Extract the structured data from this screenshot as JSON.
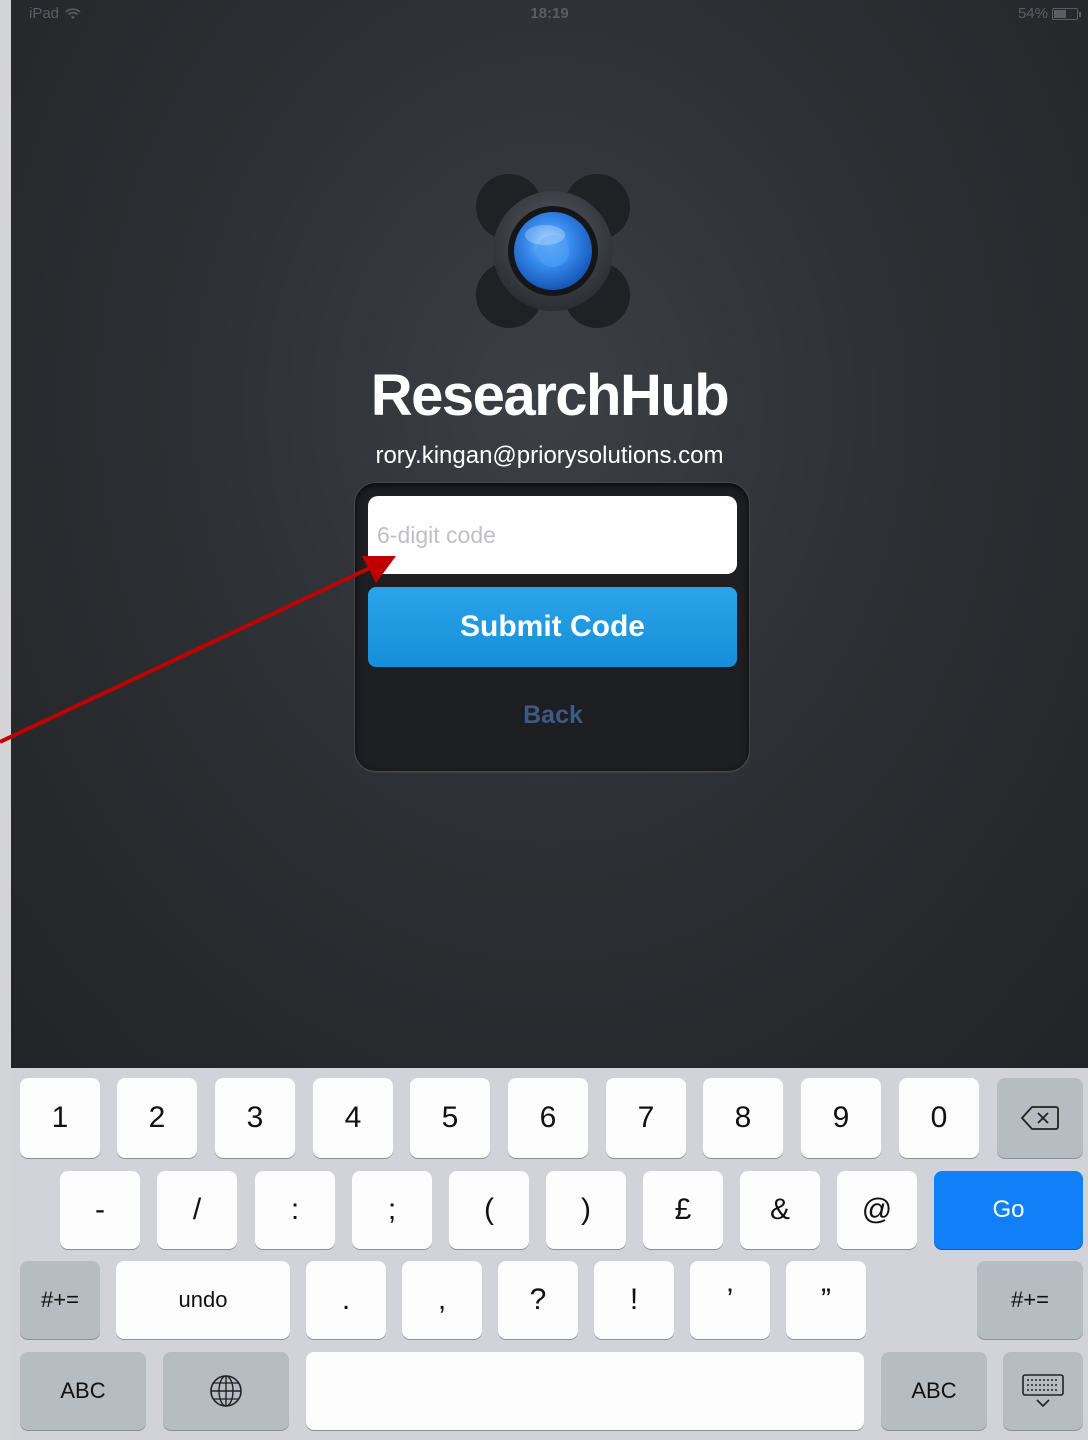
{
  "status_bar": {
    "device": "iPad",
    "time": "18:19",
    "battery": "54%",
    "battery_level": 0.54
  },
  "app": {
    "title": "ResearchHub",
    "email": "rory.kingan@priorysolutions.com",
    "code_input": {
      "placeholder": "6-digit code",
      "value": ""
    },
    "submit_label": "Submit Code",
    "back_label": "Back"
  },
  "annotation": {
    "arrow_color": "#c00000"
  },
  "colors": {
    "background": "#2d3034",
    "submit_button": "#1e98e0",
    "back_link": "#3d5a87",
    "go_key": "#117ff7"
  },
  "keyboard": {
    "row1": [
      "1",
      "2",
      "3",
      "4",
      "5",
      "6",
      "7",
      "8",
      "9",
      "0"
    ],
    "backspace_icon": "backspace-icon",
    "row2": [
      "-",
      "/",
      ":",
      ";",
      "(",
      ")",
      "£",
      "&",
      "@"
    ],
    "go_label": "Go",
    "row3_left": "#+=",
    "undo_label": "undo",
    "row3_punct": [
      ".",
      ",",
      "?",
      "!",
      "’",
      "”"
    ],
    "row3_right": "#+=",
    "row4_left": "ABC",
    "globe_icon": "globe-icon",
    "row4_right": "ABC",
    "hide_keyboard_icon": "keyboard-hide-icon"
  }
}
